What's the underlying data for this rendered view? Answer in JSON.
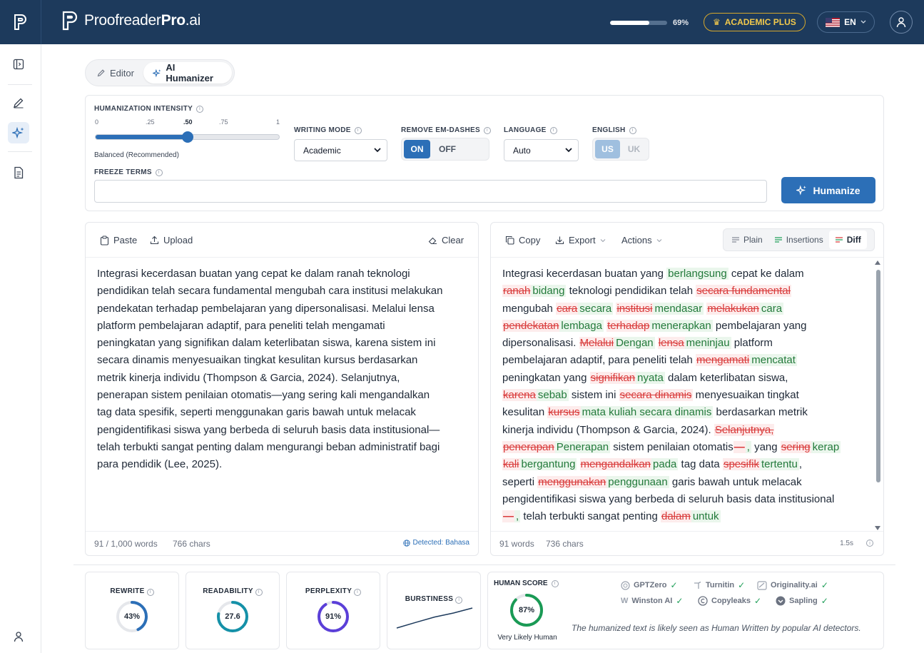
{
  "brand": {
    "name_regular": "Proofreader",
    "name_bold": "Pro",
    "name_suffix": ".ai"
  },
  "header": {
    "usage_percent": 69,
    "usage_label": "69%",
    "plan_label": "ACADEMIC PLUS",
    "language_label": "EN",
    "flag_icon": "us-flag-icon",
    "accent_color": "#1d3a5c"
  },
  "sidebar": {
    "items": [
      {
        "name": "toggle-sidebar",
        "icon": "panel-icon"
      },
      {
        "name": "editor",
        "icon": "pen-icon"
      },
      {
        "name": "ai-humanizer",
        "icon": "sparkle-icon",
        "active": true
      },
      {
        "name": "documents",
        "icon": "document-icon"
      },
      {
        "name": "account",
        "icon": "user-icon"
      }
    ]
  },
  "modes": {
    "editor_label": "Editor",
    "humanizer_label": "AI Humanizer",
    "active": "AI Humanizer"
  },
  "settings": {
    "intensity_label": "HUMANIZATION INTENSITY",
    "ticks": [
      "0",
      ".25",
      ".50",
      ".75",
      "1"
    ],
    "intensity_value": 0.5,
    "intensity_caption": "Balanced (Recommended)",
    "writing_mode_label": "WRITING MODE",
    "writing_mode_value": "Academic",
    "em_dash_label": "REMOVE EM-DASHES",
    "em_dash_on": "ON",
    "em_dash_off": "OFF",
    "language_label": "LANGUAGE",
    "language_value": "Auto",
    "english_label": "ENGLISH",
    "english_us": "US",
    "english_uk": "UK",
    "freeze_label": "FREEZE TERMS",
    "freeze_value": "",
    "humanize_button": "Humanize",
    "primary_color": "#2c6fb7"
  },
  "input_panel": {
    "paste_label": "Paste",
    "upload_label": "Upload",
    "clear_label": "Clear",
    "lines": [
      "Integrasi kecerdasan buatan yang cepat ke dalam ranah teknologi",
      "pendidikan telah secara fundamental mengubah cara institusi melakukan",
      "pendekatan terhadap pembelajaran yang dipersonalisasi. Melalui lensa",
      "platform pembelajaran adaptif, para peneliti telah mengamati",
      "peningkatan yang signifikan dalam keterlibatan siswa, karena sistem ini",
      "secara dinamis menyesuaikan tingkat kesulitan kursus berdasarkan",
      "metrik kinerja individu (Thompson & Garcia, 2024). Selanjutnya,",
      "penerapan sistem penilaian otomatis—yang sering kali mengandalkan",
      "tag data spesifik, seperti menggunakan garis bawah untuk melacak",
      "pengidentifikasi siswa yang berbeda di seluruh basis data institusional—",
      "telah terbukti sangat penting dalam mengurangi beban administratif bagi",
      "para pendidik (Lee, 2025)."
    ],
    "word_count": "91 / 1,000 words",
    "char_count": "766 chars",
    "detected": "Detected: Bahasa"
  },
  "output_panel": {
    "copy_label": "Copy",
    "export_label": "Export",
    "actions_label": "Actions",
    "view_plain": "Plain",
    "view_insertions": "Insertions",
    "view_diff": "Diff",
    "active_view": "Diff",
    "diff_lines": [
      [
        [
          "t",
          "Integrasi kecerdasan buatan yang "
        ],
        [
          "i",
          "berlangsung"
        ],
        [
          "t",
          " cepat ke dalam"
        ]
      ],
      [
        [
          "d",
          "ranah"
        ],
        [
          "i",
          "bidang"
        ],
        [
          "t",
          " teknologi pendidikan telah "
        ],
        [
          "d",
          "secara fundamental"
        ]
      ],
      [
        [
          "t",
          "mengubah "
        ],
        [
          "d",
          "cara"
        ],
        [
          "i",
          "secara"
        ],
        [
          "t",
          " "
        ],
        [
          "d",
          "institusi"
        ],
        [
          "i",
          "mendasar"
        ],
        [
          "t",
          " "
        ],
        [
          "d",
          "melakukan"
        ],
        [
          "i",
          "cara"
        ]
      ],
      [
        [
          "d",
          "pendekatan"
        ],
        [
          "i",
          "lembaga"
        ],
        [
          "t",
          " "
        ],
        [
          "d",
          "terhadap"
        ],
        [
          "i",
          "menerapkan"
        ],
        [
          "t",
          " pembelajaran yang"
        ]
      ],
      [
        [
          "t",
          "dipersonalisasi. "
        ],
        [
          "d",
          "Melalui"
        ],
        [
          "i",
          "Dengan"
        ],
        [
          "t",
          " "
        ],
        [
          "d",
          "lensa"
        ],
        [
          "i",
          "meninjau"
        ],
        [
          "t",
          " platform"
        ]
      ],
      [
        [
          "t",
          "pembelajaran adaptif, para peneliti telah "
        ],
        [
          "d",
          "mengamati"
        ],
        [
          "i",
          "mencatat"
        ]
      ],
      [
        [
          "t",
          "peningkatan yang "
        ],
        [
          "d",
          "signifikan"
        ],
        [
          "i",
          "nyata"
        ],
        [
          "t",
          " dalam keterlibatan siswa,"
        ]
      ],
      [
        [
          "d",
          "karena"
        ],
        [
          "i",
          "sebab"
        ],
        [
          "t",
          " sistem ini "
        ],
        [
          "d",
          "secara dinamis"
        ],
        [
          "t",
          " menyesuaikan tingkat"
        ]
      ],
      [
        [
          "t",
          "kesulitan "
        ],
        [
          "d",
          "kursus"
        ],
        [
          "i",
          "mata kuliah secara dinamis"
        ],
        [
          "t",
          " berdasarkan metrik"
        ]
      ],
      [
        [
          "t",
          "kinerja individu (Thompson & Garcia, 2024). "
        ],
        [
          "d",
          "Selanjutnya,"
        ]
      ],
      [
        [
          "d",
          "penerapan"
        ],
        [
          "i",
          "Penerapan"
        ],
        [
          "t",
          " sistem penilaian otomatis"
        ],
        [
          "d",
          "—"
        ],
        [
          "i",
          ","
        ],
        [
          "t",
          " yang "
        ],
        [
          "d",
          "sering"
        ],
        [
          "i",
          "kerap"
        ]
      ],
      [
        [
          "d",
          "kali"
        ],
        [
          "i",
          "bergantung"
        ],
        [
          "t",
          " "
        ],
        [
          "d",
          "mengandalkan"
        ],
        [
          "i",
          "pada"
        ],
        [
          "t",
          " tag data "
        ],
        [
          "d",
          "spesifik"
        ],
        [
          "i",
          "tertentu"
        ],
        [
          "t",
          ","
        ]
      ],
      [
        [
          "t",
          "seperti "
        ],
        [
          "d",
          "menggunakan"
        ],
        [
          "i",
          "penggunaan"
        ],
        [
          "t",
          " garis bawah untuk melacak"
        ]
      ],
      [
        [
          "t",
          "pengidentifikasi siswa yang berbeda di seluruh basis data institusional"
        ]
      ],
      [
        [
          "d",
          "—"
        ],
        [
          "i",
          ","
        ],
        [
          "t",
          " telah terbukti sangat penting "
        ],
        [
          "d",
          "dalam"
        ],
        [
          "i",
          "untuk"
        ]
      ]
    ],
    "word_count": "91 words",
    "char_count": "736 chars",
    "time": "1.5s"
  },
  "metrics": {
    "rewrite": {
      "label": "REWRITE",
      "value": 43,
      "display": "43%",
      "color": "#2c6fb7"
    },
    "readability": {
      "label": "READABILITY",
      "value": 27.6,
      "display": "27.6",
      "fraction": 0.78,
      "color": "#1591a8"
    },
    "perplexity": {
      "label": "PERPLEXITY",
      "value": 91,
      "display": "91%",
      "color": "#5b3fd8"
    },
    "burstiness": {
      "label": "BURSTINESS",
      "trend": [
        0.0,
        0.28,
        0.55,
        0.75,
        1.0
      ]
    },
    "human": {
      "label": "HUMAN SCORE",
      "value": 87,
      "display": "87%",
      "caption": "Very Likely Human",
      "color": "#1a9a55",
      "detectors": [
        "GPTZero",
        "Turnitin",
        "Originality.ai",
        "Winston AI",
        "Copyleaks",
        "Sapling"
      ],
      "note": "The humanized text is likely seen as Human Written by popular AI detectors."
    }
  }
}
